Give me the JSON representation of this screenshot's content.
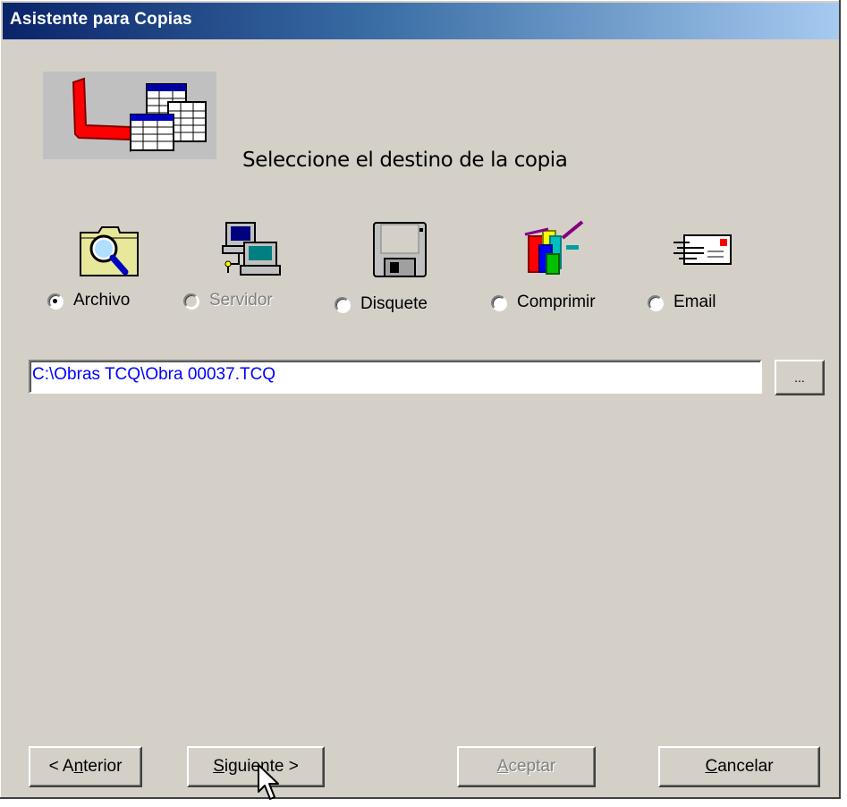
{
  "window": {
    "title": "Asistente para Copias"
  },
  "heading": "Seleccione el destino de la copia",
  "header_image_icon": "copy-tables-arrow-icon",
  "options": [
    {
      "label": "Archivo",
      "icon": "folder-search-icon",
      "selected": true,
      "enabled": true
    },
    {
      "label": "Servidor",
      "icon": "network-server-icon",
      "selected": false,
      "enabled": false
    },
    {
      "label": "Disquete",
      "icon": "floppy-disk-icon",
      "selected": false,
      "enabled": true
    },
    {
      "label": "Comprimir",
      "icon": "compressed-archive-icon",
      "selected": false,
      "enabled": true
    },
    {
      "label": "Email",
      "icon": "email-envelope-icon",
      "selected": false,
      "enabled": true
    }
  ],
  "path": {
    "value": "C:\\Obras TCQ\\Obra 00037.TCQ",
    "color": "#0000ff"
  },
  "browse_button": {
    "label": "..."
  },
  "buttons": {
    "back": {
      "label": "< Anterior",
      "accesskey": "n"
    },
    "next": {
      "label": "Siguiente >",
      "accesskey": "S"
    },
    "accept": {
      "label": "Aceptar",
      "enabled": false,
      "accesskey": "A"
    },
    "cancel": {
      "label": "Cancelar",
      "accesskey": "C"
    }
  },
  "colors": {
    "title_start": "#0a246a",
    "title_end": "#a6caf0",
    "dialog_bg": "#d4d0c8"
  }
}
